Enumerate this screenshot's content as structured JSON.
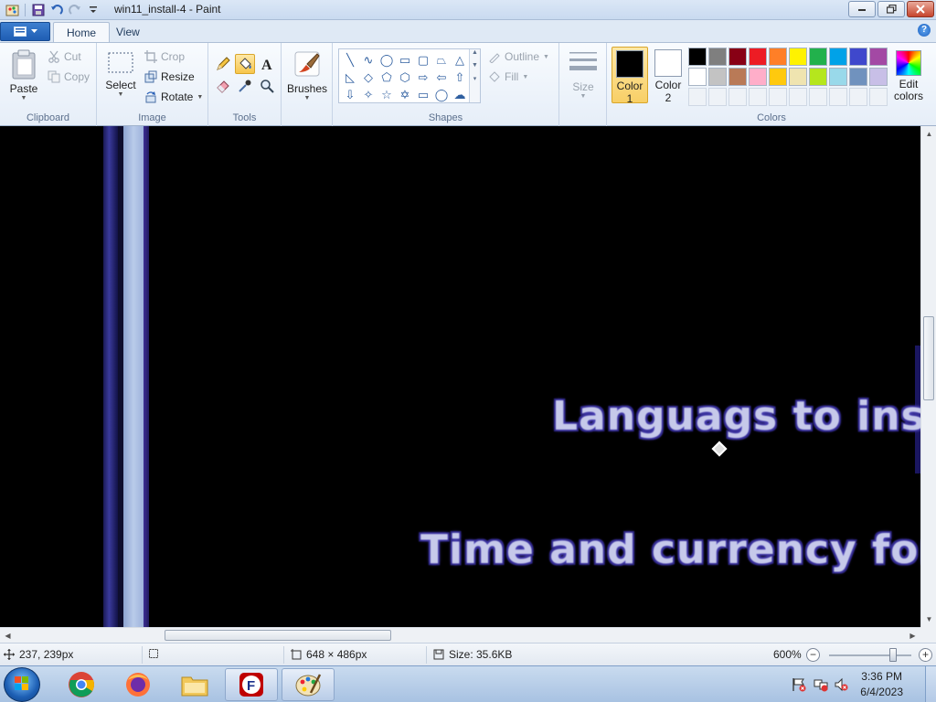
{
  "window": {
    "title": "win11_install-4 - Paint"
  },
  "ribbon": {
    "tabs": [
      {
        "label": "Home",
        "active": true
      },
      {
        "label": "View",
        "active": false
      }
    ],
    "clipboard": {
      "label": "Clipboard",
      "paste": "Paste",
      "cut": "Cut",
      "copy": "Copy"
    },
    "image": {
      "label": "Image",
      "select": "Select",
      "crop": "Crop",
      "resize": "Resize",
      "rotate": "Rotate"
    },
    "tools": {
      "label": "Tools",
      "selected": "fill"
    },
    "brushes": {
      "label": "Brushes"
    },
    "shapes": {
      "label": "Shapes",
      "outline": "Outline",
      "fill": "Fill"
    },
    "size": {
      "label": "Size"
    },
    "colors": {
      "label": "Colors",
      "color1_label_a": "Color",
      "color1_label_b": "1",
      "color2_label_a": "Color",
      "color2_label_b": "2",
      "color1": "#000000",
      "color2": "#ffffff",
      "edit_a": "Edit",
      "edit_b": "colors",
      "palette_row1": [
        "#000000",
        "#7f7f7f",
        "#880015",
        "#ed1c24",
        "#ff7f27",
        "#fff200",
        "#22b14c",
        "#00a2e8",
        "#3f48cc",
        "#a349a4"
      ],
      "palette_row2": [
        "#ffffff",
        "#c3c3c3",
        "#b97a57",
        "#ffaec9",
        "#ffc90e",
        "#efe4b0",
        "#b5e61d",
        "#99d9ea",
        "#7092be",
        "#c8bfe7"
      ]
    }
  },
  "canvas": {
    "text_line_1": "Languags to install:",
    "text_line_2": "Time and currency format:"
  },
  "statusbar": {
    "cursor_pos": "237, 239px",
    "image_size": "648 × 486px",
    "file_size": "Size: 35.6KB",
    "zoom": "600%",
    "zoom_level_percent": 600
  },
  "taskbar": {
    "time": "3:36 PM",
    "date": "6/4/2023",
    "apps": [
      "chrome",
      "firefox",
      "file-explorer",
      "filezilla",
      "paint"
    ]
  }
}
